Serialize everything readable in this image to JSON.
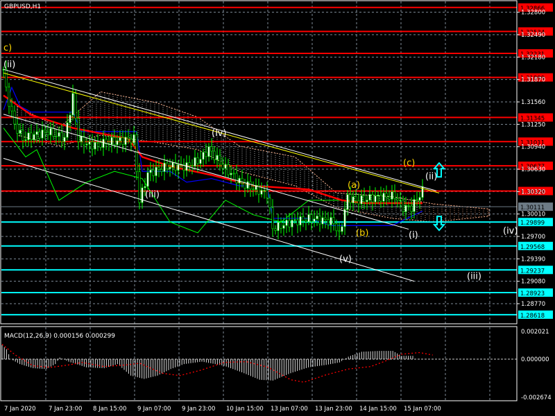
{
  "title": "GBPUSD,H1",
  "colors": {
    "bg": "#000000",
    "grid": "#7f8c99",
    "resistance": "#ff0000",
    "support": "#00ffff",
    "current": "#6d7b86",
    "bull": "#00ff00",
    "wave_white": "#ffffff",
    "wave_yellow": "#ffd700",
    "ma": "#ff0000",
    "kijun": "#0000ff",
    "chikou": "#00ff00",
    "cloud": "#ffb08a"
  },
  "chart_data": [
    {
      "type": "line",
      "title": "GBPUSD,H1",
      "ylim": [
        1.2838,
        1.3295
      ],
      "y_ticks": [
        "1.32800",
        "1.32490",
        "1.32180",
        "1.31870",
        "1.31560",
        "1.31250",
        "1.30940",
        "1.30630",
        "1.30320",
        "1.30010",
        "1.29700",
        "1.29390",
        "1.29080",
        "1.28770"
      ],
      "x_ticks": [
        {
          "hour": 0,
          "label": "7 Jan 2020"
        },
        {
          "hour": 16,
          "label": "7 Jan 23:00"
        },
        {
          "hour": 32,
          "label": "8 Jan 15:00"
        },
        {
          "hour": 48,
          "label": "9 Jan 07:00"
        },
        {
          "hour": 64,
          "label": "9 Jan 23:00"
        },
        {
          "hour": 80,
          "label": "10 Jan 15:00"
        },
        {
          "hour": 96,
          "label": "13 Jan 07:00"
        },
        {
          "hour": 112,
          "label": "13 Jan 23:00"
        },
        {
          "hour": 128,
          "label": "14 Jan 15:00"
        },
        {
          "hour": 144,
          "label": "15 Jan 07:00"
        }
      ],
      "resistance_levels": [
        "1.32866",
        "1.32534",
        "1.32231",
        "1.31899",
        "1.31345",
        "1.31011",
        "1.30677",
        "1.30328"
      ],
      "current_price": "1.30111",
      "support_levels": [
        "1.29899",
        "1.29568",
        "1.29237",
        "1.28923",
        "1.28618"
      ],
      "price_path": [
        [
          0,
          1.3201
        ],
        [
          1,
          1.3172
        ],
        [
          4,
          1.3124
        ],
        [
          7,
          1.3105
        ],
        [
          11,
          1.311
        ],
        [
          16,
          1.3115
        ],
        [
          22,
          1.3105
        ],
        [
          25,
          1.3163
        ],
        [
          27,
          1.3105
        ],
        [
          31,
          1.3096
        ],
        [
          39,
          1.3101
        ],
        [
          47,
          1.3105
        ],
        [
          49,
          1.3019
        ],
        [
          52,
          1.3057
        ],
        [
          59,
          1.3067
        ],
        [
          66,
          1.3067
        ],
        [
          71,
          1.3077
        ],
        [
          74,
          1.3091
        ],
        [
          79,
          1.3067
        ],
        [
          86,
          1.3043
        ],
        [
          95,
          1.3029
        ],
        [
          97,
          1.2981
        ],
        [
          104,
          1.299
        ],
        [
          111,
          1.2995
        ],
        [
          119,
          1.299
        ],
        [
          121,
          1.2971
        ],
        [
          124,
          1.3024
        ],
        [
          127,
          1.3019
        ],
        [
          134,
          1.3024
        ],
        [
          141,
          1.3026
        ],
        [
          144,
          1.301
        ],
        [
          147,
          1.301
        ],
        [
          151,
          1.3033
        ]
      ],
      "ma_line": [
        [
          0,
          1.3165
        ],
        [
          10,
          1.3138
        ],
        [
          25,
          1.312
        ],
        [
          45,
          1.3105
        ],
        [
          50,
          1.308
        ],
        [
          60,
          1.3067
        ],
        [
          75,
          1.3055
        ],
        [
          90,
          1.304
        ],
        [
          110,
          1.3035
        ],
        [
          122,
          1.302
        ],
        [
          130,
          1.3016
        ],
        [
          151,
          1.3016
        ]
      ],
      "kijun_line": [
        [
          0,
          1.3145
        ],
        [
          3,
          1.3176
        ],
        [
          6,
          1.315
        ],
        [
          10,
          1.3142
        ],
        [
          25,
          1.3142
        ],
        [
          28,
          1.3115
        ],
        [
          48,
          1.3115
        ],
        [
          50,
          1.306
        ],
        [
          60,
          1.306
        ],
        [
          66,
          1.3045
        ],
        [
          75,
          1.305
        ],
        [
          85,
          1.304
        ],
        [
          95,
          1.304
        ],
        [
          97,
          1.2995
        ],
        [
          110,
          1.2995
        ],
        [
          118,
          1.2985
        ],
        [
          140,
          1.2985
        ],
        [
          151,
          1.3005
        ]
      ],
      "chikou_line": [
        [
          0,
          1.312
        ],
        [
          8,
          1.308
        ],
        [
          12,
          1.309
        ],
        [
          20,
          1.302
        ],
        [
          30,
          1.3045
        ],
        [
          40,
          1.306
        ],
        [
          50,
          1.305
        ],
        [
          60,
          1.299
        ],
        [
          70,
          1.2975
        ],
        [
          80,
          1.302
        ],
        [
          90,
          1.3
        ],
        [
          100,
          1.299
        ],
        [
          110,
          1.302
        ],
        [
          125,
          1.302
        ]
      ],
      "cloud_ranges": [
        [
          5,
          1.315,
          1.311
        ],
        [
          20,
          1.312,
          1.3095
        ],
        [
          35,
          1.317,
          1.311
        ],
        [
          55,
          1.3155,
          1.31
        ],
        [
          70,
          1.3135,
          1.309
        ],
        [
          85,
          1.3095,
          1.306
        ],
        [
          105,
          1.308,
          1.304
        ],
        [
          120,
          1.303,
          1.301
        ],
        [
          140,
          1.3025,
          1.2995
        ],
        [
          155,
          1.3015,
          1.299
        ],
        [
          175,
          1.3008,
          1.2998
        ]
      ],
      "trendlines": [
        {
          "color": "#ffffff",
          "from": [
            0,
            1.3201
          ],
          "to": [
            156,
            1.3033
          ]
        },
        {
          "color": "#ffff00",
          "from": [
            0,
            1.3196
          ],
          "to": [
            157,
            1.303
          ]
        },
        {
          "color": "#ffffff",
          "from": [
            0,
            1.3139
          ],
          "to": [
            146,
            1.298
          ]
        },
        {
          "color": "#ffffff",
          "from": [
            0,
            1.3078
          ],
          "to": [
            148,
            1.2908
          ]
        }
      ],
      "wave_labels": [
        {
          "text": "c)",
          "hour": 0,
          "price": 1.3227,
          "color": "yellow"
        },
        {
          "text": "(ii)",
          "hour": 0,
          "price": 1.3204,
          "color": "white"
        },
        {
          "text": "(iii)",
          "hour": 51,
          "price": 1.3024,
          "color": "white"
        },
        {
          "text": "(iv)",
          "hour": 75,
          "price": 1.3109,
          "color": "white"
        },
        {
          "text": "(v)",
          "hour": 121,
          "price": 1.2935,
          "color": "white"
        },
        {
          "text": "(a)",
          "hour": 124,
          "price": 1.3037,
          "color": "yellow"
        },
        {
          "text": "(b)",
          "hour": 127,
          "price": 1.2971,
          "color": "yellow"
        },
        {
          "text": "(c)",
          "hour": 144,
          "price": 1.3068,
          "color": "yellow"
        },
        {
          "text": "(ii)",
          "hour": 152,
          "price": 1.3049,
          "color": "white"
        },
        {
          "text": "(i)",
          "hour": 146,
          "price": 1.2968,
          "color": "white"
        },
        {
          "text": "(iv)",
          "hour": 180,
          "price": 1.2974,
          "color": "white"
        },
        {
          "text": "(iii)",
          "hour": 167,
          "price": 1.2911,
          "color": "white"
        }
      ],
      "arrows": [
        {
          "dir": "up",
          "hour": 157,
          "price": 1.306
        },
        {
          "dir": "down",
          "hour": 157,
          "price": 1.299
        }
      ]
    },
    {
      "type": "bar",
      "title": "MACD(12,26,9) 0.000156 0.000299",
      "ylim": [
        -0.002674,
        0.002021
      ],
      "y_ticks": [
        "0.002021",
        "0.000000",
        "-0.002674"
      ],
      "histogram": [
        [
          0,
          0.0017
        ],
        [
          2,
          0.0012
        ],
        [
          4,
          0.0
        ],
        [
          8,
          -0.0006
        ],
        [
          14,
          -0.0011
        ],
        [
          20,
          -0.0012
        ],
        [
          24,
          -0.0006
        ],
        [
          26,
          0.0002
        ],
        [
          30,
          -0.0003
        ],
        [
          38,
          -0.001
        ],
        [
          46,
          -0.0011
        ],
        [
          52,
          -0.0006
        ],
        [
          58,
          -0.002
        ],
        [
          64,
          -0.0024
        ],
        [
          70,
          -0.002
        ],
        [
          76,
          -0.0012
        ],
        [
          82,
          -0.0006
        ],
        [
          90,
          -0.0003
        ],
        [
          100,
          -0.0008
        ],
        [
          108,
          -0.0016
        ],
        [
          116,
          -0.0025
        ],
        [
          122,
          -0.0026
        ],
        [
          130,
          -0.0017
        ],
        [
          138,
          -0.001
        ],
        [
          146,
          -0.0007
        ],
        [
          152,
          -0.0004
        ],
        [
          156,
          0.0003
        ],
        [
          162,
          0.0009
        ],
        [
          170,
          0.001
        ],
        [
          176,
          0.001
        ],
        [
          180,
          0.0004
        ],
        [
          185,
          0.0004
        ]
      ],
      "signal": [
        [
          0,
          0.0018
        ],
        [
          6,
          0.0005
        ],
        [
          14,
          -0.0008
        ],
        [
          22,
          -0.001
        ],
        [
          30,
          -0.0007
        ],
        [
          36,
          -0.0004
        ],
        [
          46,
          -0.0009
        ],
        [
          56,
          -0.0007
        ],
        [
          62,
          -0.0005
        ],
        [
          72,
          -0.0017
        ],
        [
          80,
          -0.002
        ],
        [
          90,
          -0.0013
        ],
        [
          100,
          -0.0004
        ],
        [
          110,
          -0.0003
        ],
        [
          120,
          -0.001
        ],
        [
          130,
          -0.0025
        ],
        [
          136,
          -0.0028
        ],
        [
          146,
          -0.0019
        ],
        [
          156,
          -0.0012
        ],
        [
          166,
          -0.0009
        ],
        [
          172,
          -0.0003
        ],
        [
          180,
          0.0006
        ],
        [
          188,
          0.0008
        ],
        [
          194,
          0.0005
        ]
      ]
    }
  ]
}
